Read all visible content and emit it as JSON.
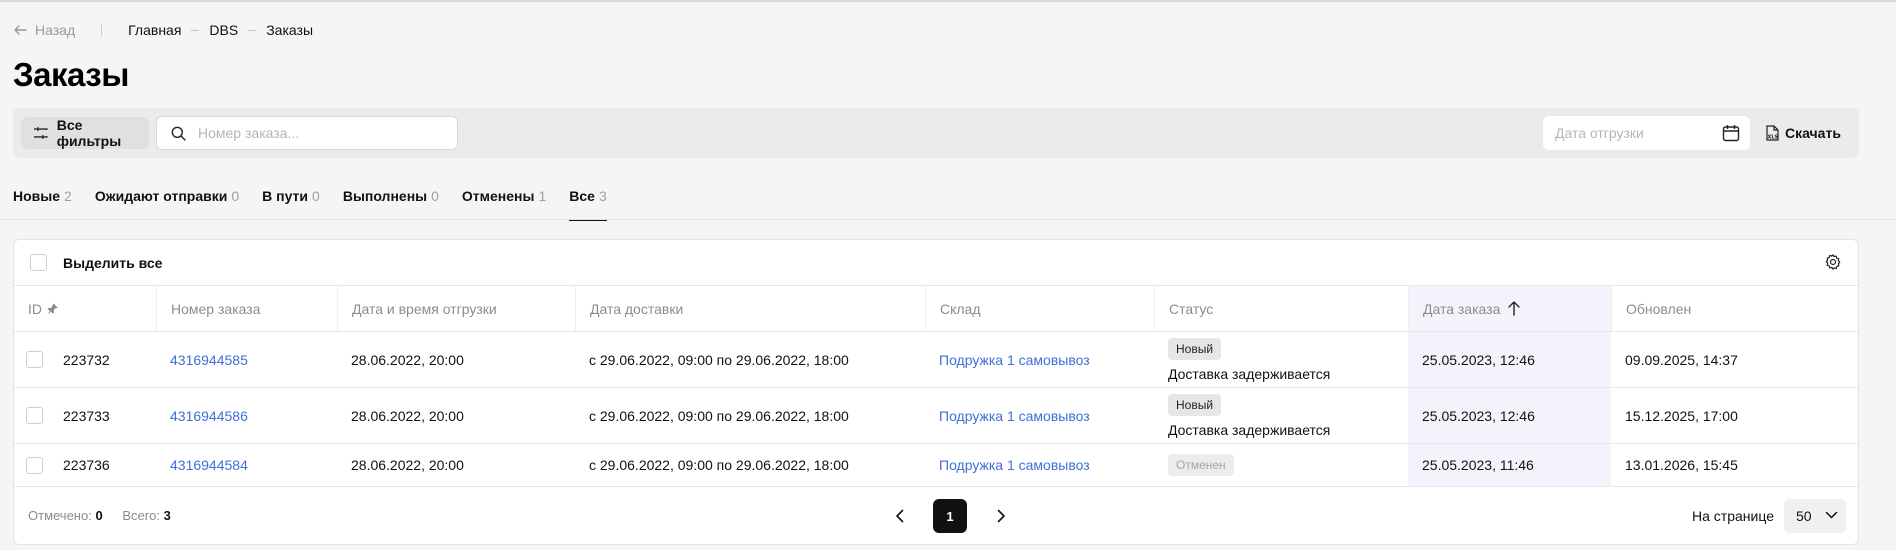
{
  "nav": {
    "back_label": "Назад",
    "breadcrumbs": [
      "Главная",
      "DBS",
      "Заказы"
    ]
  },
  "page_title": "Заказы",
  "filters": {
    "all_filters_label": "Все фильтры",
    "search_placeholder": "Номер заказа...",
    "ship_date_placeholder": "Дата отгрузки",
    "download_label": "Скачать"
  },
  "tabs": [
    {
      "label": "Новые",
      "count": "2"
    },
    {
      "label": "Ожидают отправки",
      "count": "0"
    },
    {
      "label": "В пути",
      "count": "0"
    },
    {
      "label": "Выполнены",
      "count": "0"
    },
    {
      "label": "Отменены",
      "count": "1"
    },
    {
      "label": "Все",
      "count": "3",
      "active": true
    }
  ],
  "table": {
    "select_all_label": "Выделить все",
    "columns": [
      "ID",
      "Номер заказа",
      "Дата и время отгрузки",
      "Дата доставки",
      "Склад",
      "Статус",
      "Дата заказа",
      "Обновлен"
    ],
    "sorted_column": "Дата заказа",
    "rows": [
      {
        "id": "223732",
        "order_number": "4316944585",
        "ship_datetime": "28.06.2022, 20:00",
        "delivery_date": "с 29.06.2022, 09:00 по 29.06.2022, 18:00",
        "warehouse": "Подружка 1 самовывоз",
        "status": "Новый",
        "status_note": "Доставка задерживается",
        "order_date": "25.05.2023, 12:46",
        "updated": "09.09.2025, 14:37"
      },
      {
        "id": "223733",
        "order_number": "4316944586",
        "ship_datetime": "28.06.2022, 20:00",
        "delivery_date": "с 29.06.2022, 09:00 по 29.06.2022, 18:00",
        "warehouse": "Подружка 1 самовывоз",
        "status": "Новый",
        "status_note": "Доставка задерживается",
        "order_date": "25.05.2023, 12:46",
        "updated": "15.12.2025, 17:00"
      },
      {
        "id": "223736",
        "order_number": "4316944584",
        "ship_datetime": "28.06.2022, 20:00",
        "delivery_date": "с 29.06.2022, 09:00 по 29.06.2022, 18:00",
        "warehouse": "Подружка 1 самовывоз",
        "status": "Отменен",
        "status_note": "",
        "order_date": "25.05.2023, 11:46",
        "updated": "13.01.2026, 15:45"
      }
    ]
  },
  "footer": {
    "selected_label": "Отмечено:",
    "selected_value": "0",
    "total_label": "Всего:",
    "total_value": "3",
    "current_page": "1",
    "per_page_label": "На странице",
    "per_page_value": "50"
  },
  "icons": {
    "back": "arrow-left-icon",
    "filters": "sliders-icon",
    "search": "search-icon",
    "calendar": "calendar-icon",
    "download": "xls-file-icon",
    "settings": "gear-icon",
    "pin": "pin-icon",
    "sort": "arrow-up-icon"
  },
  "colors": {
    "link": "#3f6fd8",
    "sorted_column_bg": "#f3f3fb",
    "active_page": "#111111"
  }
}
